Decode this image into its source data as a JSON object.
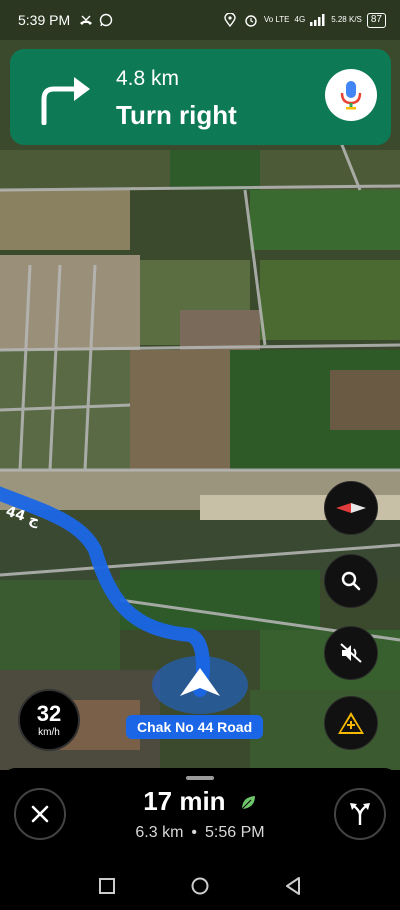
{
  "status_bar": {
    "time": "5:39 PM",
    "left_icons": [
      "missed-call-icon",
      "whatsapp-icon"
    ],
    "right_icons": [
      "location-icon",
      "alarm-icon",
      "volte-icon",
      "4g-signal-icon"
    ],
    "volte_text": "Vo LTE",
    "network_text": "4G",
    "speed_text": "5.28 K/S",
    "battery": "87"
  },
  "banner": {
    "distance": "4.8 km",
    "instruction": "Turn right",
    "color": "#0e7a55"
  },
  "map": {
    "road_label": "Chak No 44 Road",
    "route_color": "#1a66e6",
    "route_road_text": "44 ج"
  },
  "speed": {
    "value": "32",
    "unit": "km/h"
  },
  "trip": {
    "duration": "17 min",
    "distance": "6.3 km",
    "separator": "•",
    "arrival": "5:56 PM"
  },
  "buttons": [
    "compass-icon",
    "search-icon",
    "mute-icon",
    "report-incident-icon",
    "close-icon",
    "route-options-icon"
  ],
  "nav_bar": [
    "recents-button",
    "home-button",
    "back-button"
  ]
}
